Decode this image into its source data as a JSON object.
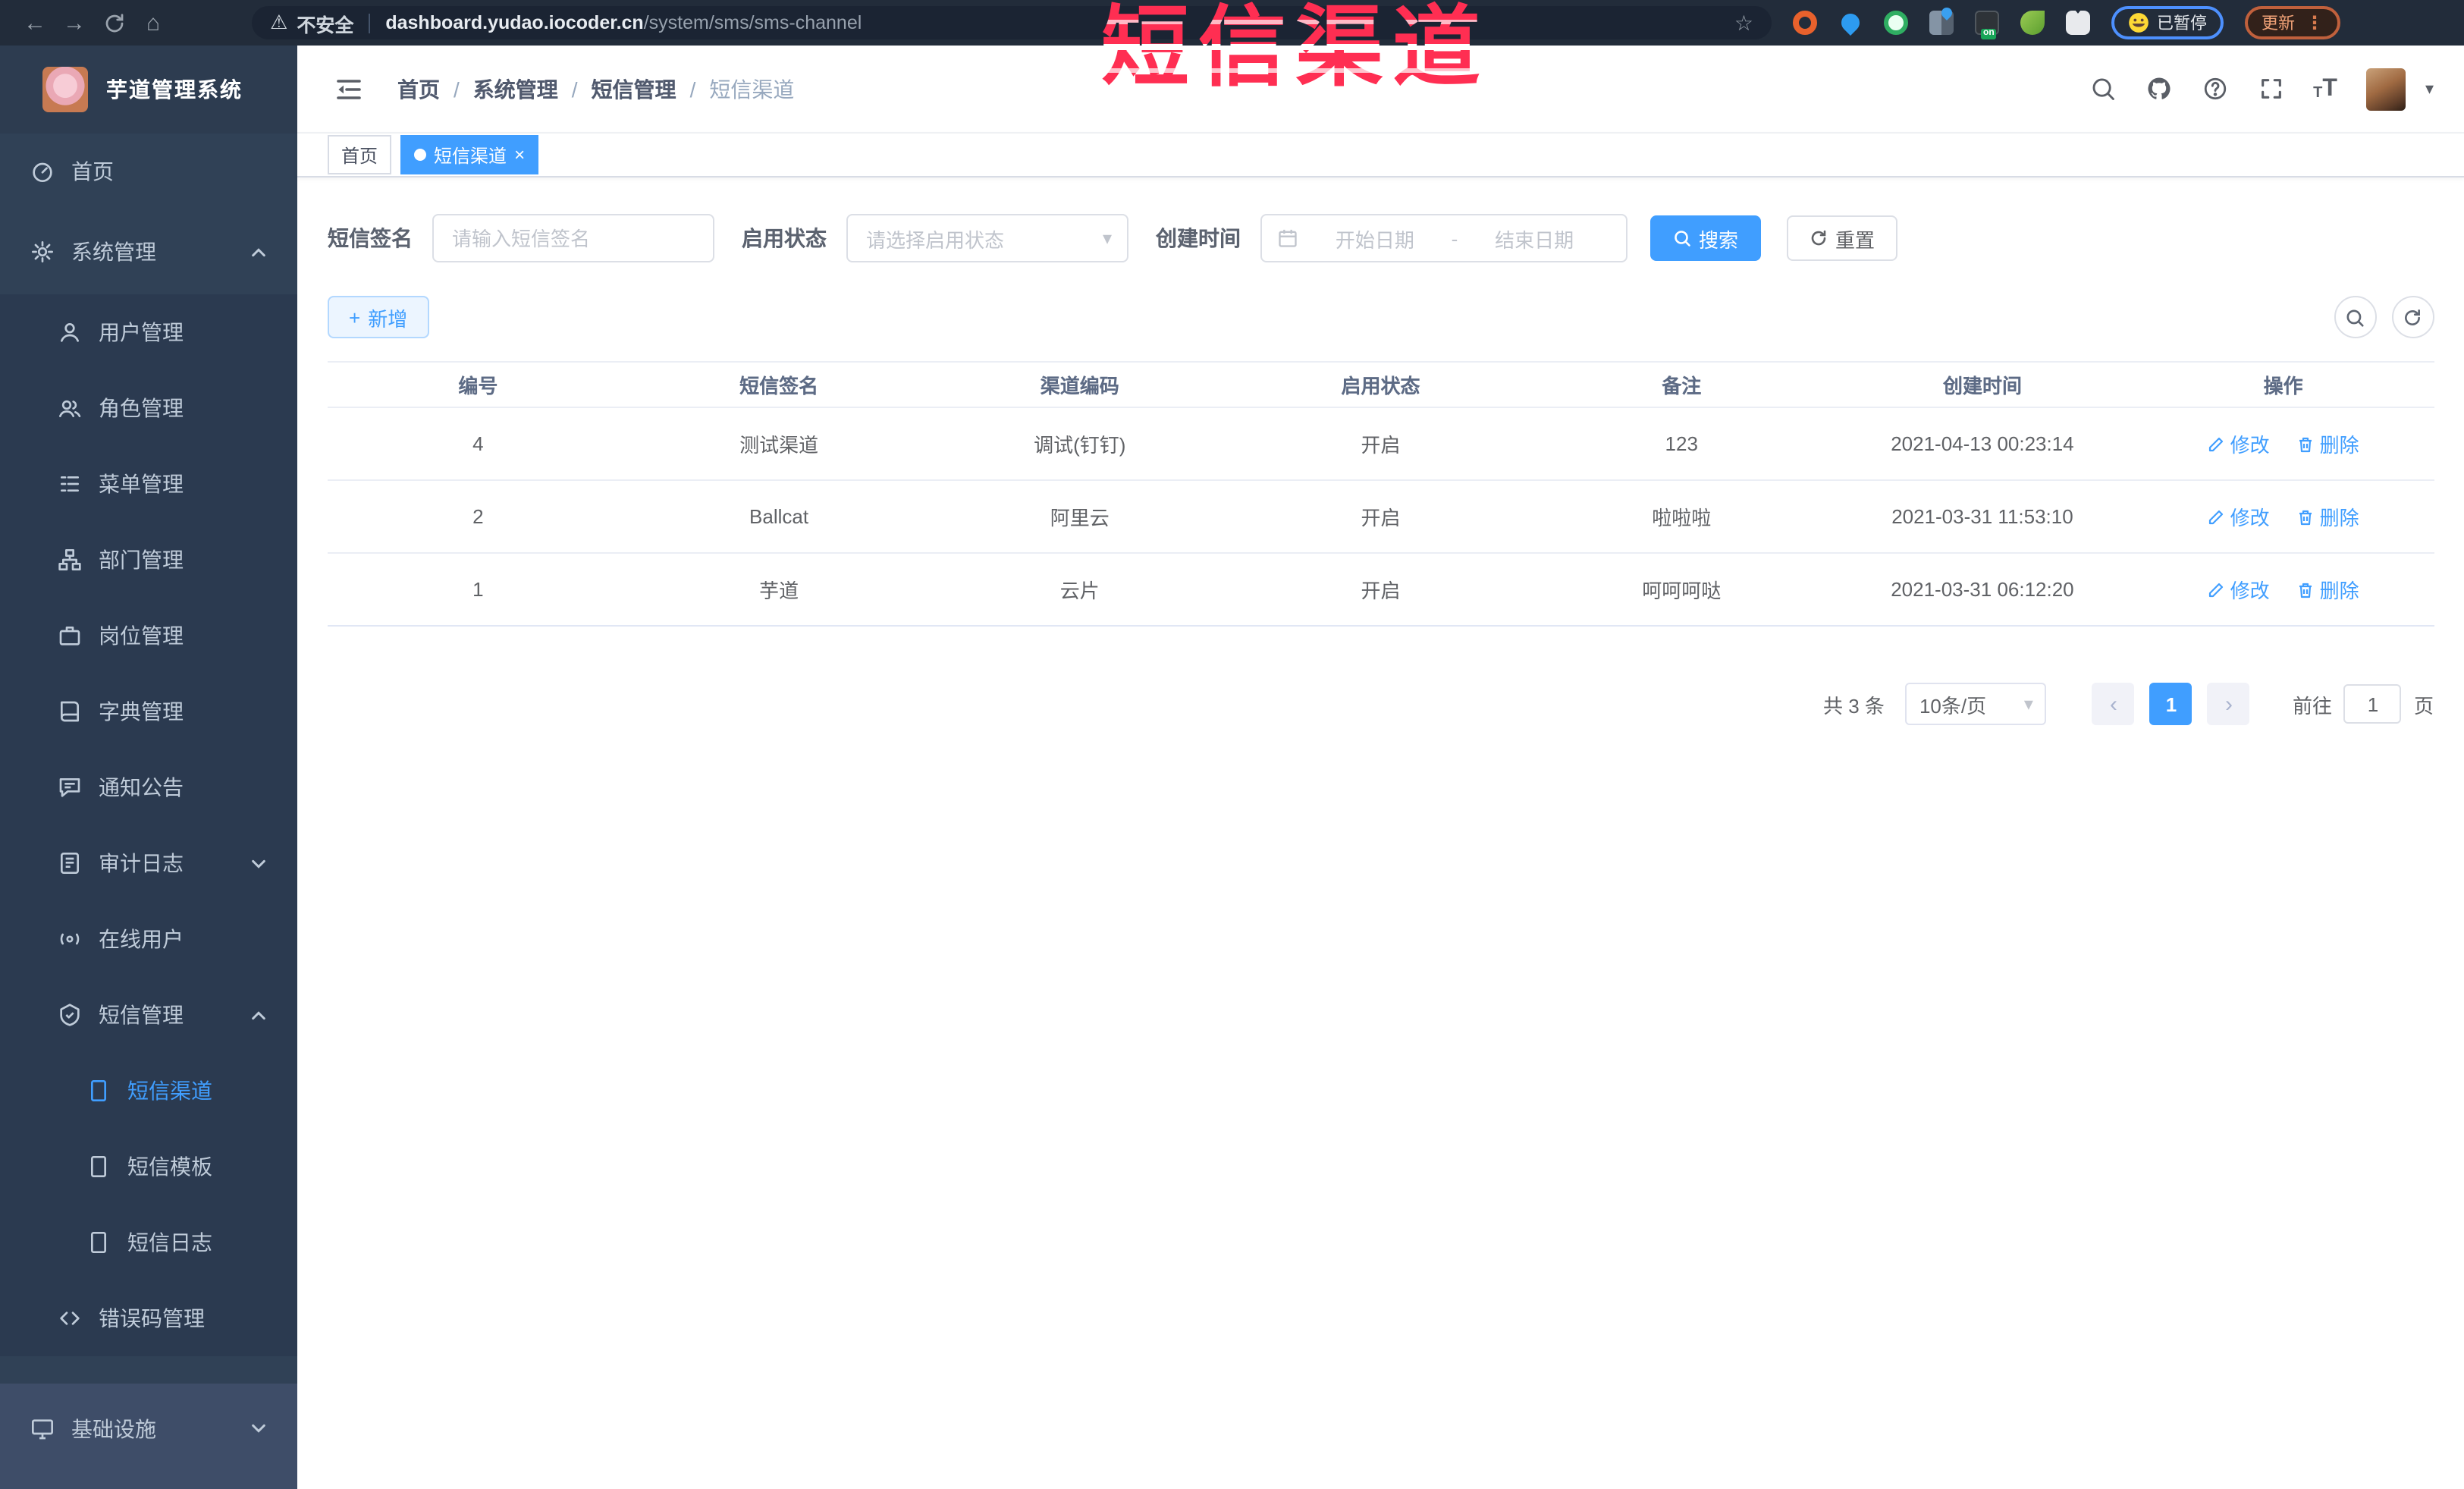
{
  "browser": {
    "security_label": "不安全",
    "url_domain": "dashboard.yudao.iocoder.cn",
    "url_path": "/system/sms/sms-channel",
    "paused_label": "已暂停",
    "update_label": "更新"
  },
  "watermark_text": "短信渠道",
  "icons": {
    "back": "←",
    "forward": "→",
    "home": "⌂",
    "warning": "⚠",
    "star": "☆",
    "menu_dots": "⋮",
    "caret_down": "▾",
    "chevron_left": "‹",
    "chevron_right": "›",
    "close": "×",
    "slash": "/",
    "plus": "+",
    "on_badge": "on",
    "font_t": "T"
  },
  "sidebar": {
    "title": "芋道管理系统",
    "items": [
      {
        "label": "首页",
        "level": 1,
        "icon": "dashboard-icon"
      },
      {
        "label": "系统管理",
        "level": 1,
        "icon": "gear-icon",
        "caret": "up"
      },
      {
        "label": "用户管理",
        "level": 2,
        "icon": "user-icon"
      },
      {
        "label": "角色管理",
        "level": 2,
        "icon": "users-icon"
      },
      {
        "label": "菜单管理",
        "level": 2,
        "icon": "menu-list-icon"
      },
      {
        "label": "部门管理",
        "level": 2,
        "icon": "org-tree-icon"
      },
      {
        "label": "岗位管理",
        "level": 2,
        "icon": "briefcase-icon"
      },
      {
        "label": "字典管理",
        "level": 2,
        "icon": "dictionary-icon"
      },
      {
        "label": "通知公告",
        "level": 2,
        "icon": "announcement-icon"
      },
      {
        "label": "审计日志",
        "level": 2,
        "icon": "audit-log-icon",
        "caret": "down"
      },
      {
        "label": "在线用户",
        "level": 2,
        "icon": "online-user-icon"
      },
      {
        "label": "短信管理",
        "level": 2,
        "icon": "sms-shield-icon",
        "caret": "up"
      },
      {
        "label": "短信渠道",
        "level": 3,
        "icon": "document-icon",
        "active": true
      },
      {
        "label": "短信模板",
        "level": 3,
        "icon": "document-icon"
      },
      {
        "label": "短信日志",
        "level": 3,
        "icon": "document-icon"
      },
      {
        "label": "错误码管理",
        "level": 2,
        "icon": "code-icon"
      },
      {
        "label": "基础设施",
        "level": 1,
        "icon": "monitor-icon",
        "caret": "down"
      }
    ]
  },
  "header": {
    "breadcrumb": [
      "首页",
      "系统管理",
      "短信管理",
      "短信渠道"
    ]
  },
  "tabs": [
    {
      "label": "首页"
    },
    {
      "label": "短信渠道",
      "active": true
    }
  ],
  "filters": {
    "signature_label": "短信签名",
    "signature_placeholder": "请输入短信签名",
    "status_label": "启用状态",
    "status_placeholder": "请选择启用状态",
    "created_label": "创建时间",
    "date_start_placeholder": "开始日期",
    "date_separator": "-",
    "date_end_placeholder": "结束日期",
    "search_label": "搜索",
    "reset_label": "重置"
  },
  "toolbar": {
    "add_label": "新增"
  },
  "table": {
    "headers": [
      "编号",
      "短信签名",
      "渠道编码",
      "启用状态",
      "备注",
      "创建时间",
      "操作"
    ],
    "edit_label": "修改",
    "delete_label": "删除",
    "rows": [
      {
        "id": "4",
        "signature": "测试渠道",
        "code": "调试(钉钉)",
        "status": "开启",
        "remark": "123",
        "created": "2021-04-13 00:23:14"
      },
      {
        "id": "2",
        "signature": "Ballcat",
        "code": "阿里云",
        "status": "开启",
        "remark": "啦啦啦",
        "created": "2021-03-31 11:53:10"
      },
      {
        "id": "1",
        "signature": "芋道",
        "code": "云片",
        "status": "开启",
        "remark": "呵呵呵哒",
        "created": "2021-03-31 06:12:20"
      }
    ]
  },
  "pagination": {
    "total_text": "共 3 条",
    "page_size": "10条/页",
    "current_page": "1",
    "goto_label": "前往",
    "goto_value": "1",
    "page_suffix": "页"
  },
  "colors": {
    "accent": "#409eff",
    "sidebar_bg": "#304156",
    "chrome_bg": "#222c3a",
    "watermark_red": "#ff2e52",
    "active_tab": "#409eff"
  }
}
